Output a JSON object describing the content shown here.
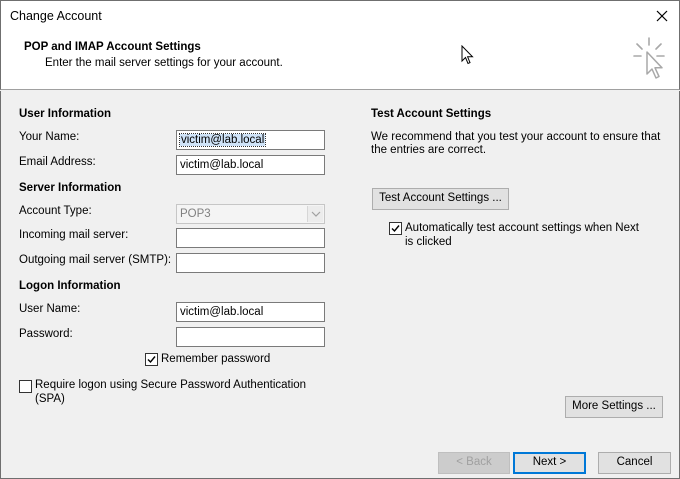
{
  "window": {
    "title": "Change Account"
  },
  "header": {
    "title": "POP and IMAP Account Settings",
    "subtitle": "Enter the mail server settings for your account."
  },
  "user_information": {
    "heading": "User Information",
    "your_name_label": "Your Name:",
    "your_name_value": "victim@lab.local",
    "email_label": "Email Address:",
    "email_value": "victim@lab.local"
  },
  "server_information": {
    "heading": "Server Information",
    "account_type_label": "Account Type:",
    "account_type_value": "POP3",
    "incoming_label": "Incoming mail server:",
    "incoming_value": "",
    "outgoing_label": "Outgoing mail server (SMTP):",
    "outgoing_value": ""
  },
  "logon_information": {
    "heading": "Logon Information",
    "username_label": "User Name:",
    "username_value": "victim@lab.local",
    "password_label": "Password:",
    "password_value": "",
    "remember_password_label": "Remember password",
    "remember_password_checked": true,
    "spa_label_line1": "Require logon using Secure Password Authentication",
    "spa_label_line2": "(SPA)",
    "spa_checked": false
  },
  "test_settings": {
    "heading": "Test Account Settings",
    "description_line1": "We recommend that you test your account to ensure that",
    "description_line2": "the entries are correct.",
    "test_button_label": "Test Account Settings ...",
    "auto_test_line1": "Automatically test account settings when Next",
    "auto_test_line2": "is clicked",
    "auto_test_checked": true
  },
  "more_settings_label": "More Settings ...",
  "footer": {
    "back_label": "< Back",
    "next_label": "Next >",
    "cancel_label": "Cancel"
  },
  "colors": {
    "focus_border": "#0078d7",
    "selection": "#cfe3f8"
  },
  "icons": [
    "close-icon",
    "mouse-cursor-icon",
    "click-cursor-logo-icon",
    "checkmark-icon",
    "chevron-down-icon"
  ]
}
